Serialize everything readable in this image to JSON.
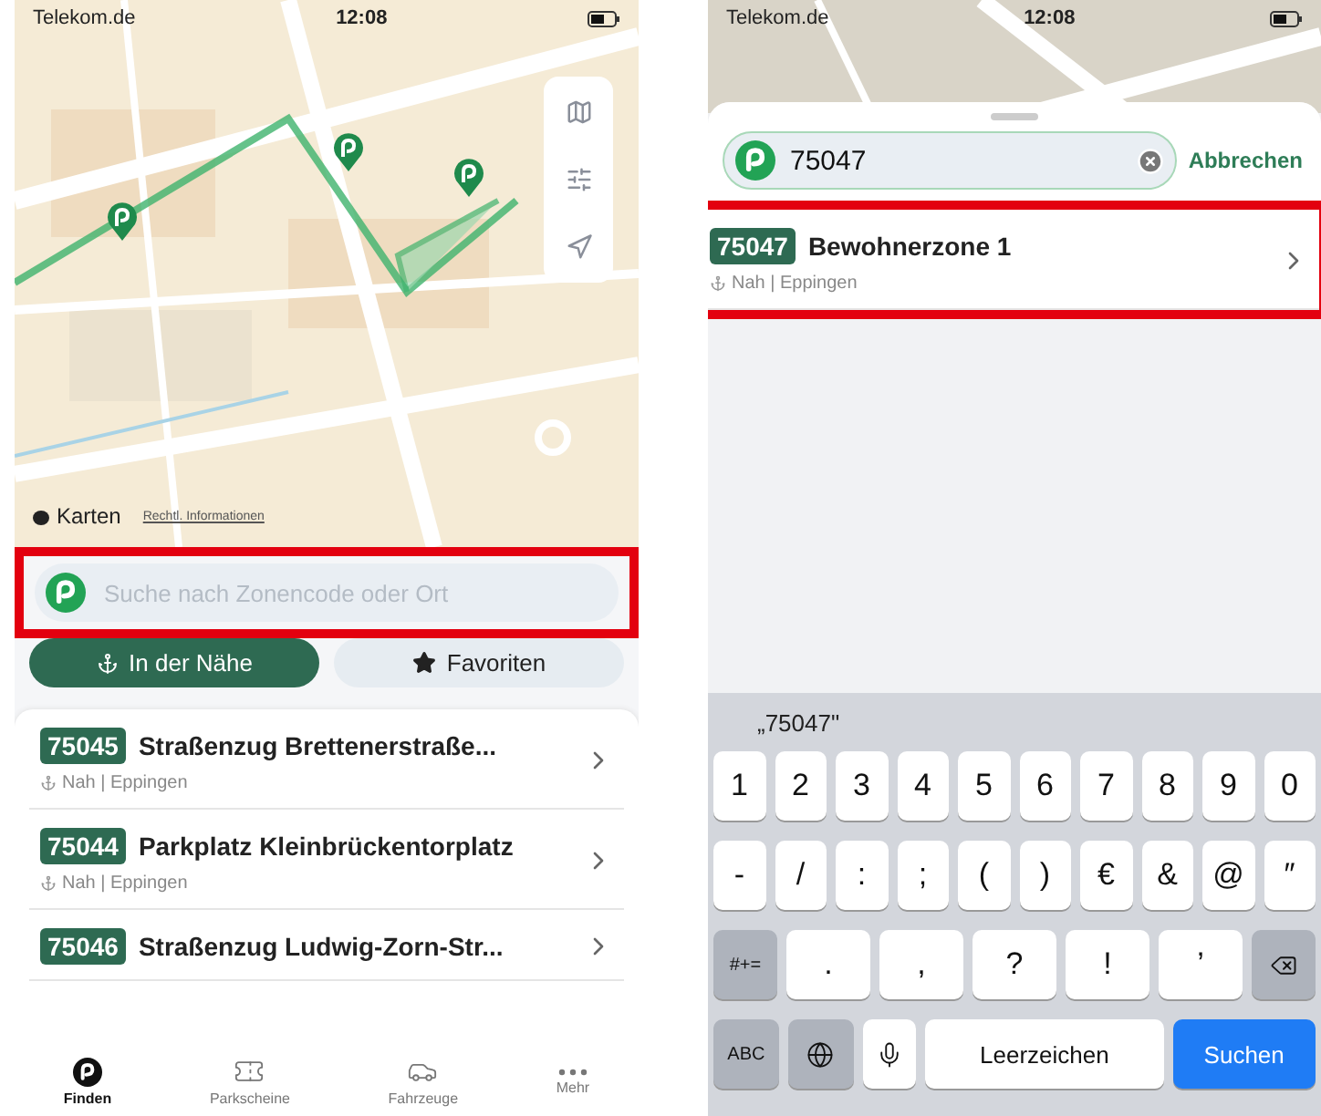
{
  "left_screen": {
    "status_bar": {
      "carrier": "Telekom.de",
      "time": "12:08"
    },
    "map": {
      "brand": "Karten",
      "legal_link": "Rechtl. Informationen"
    },
    "search": {
      "placeholder": "Suche nach Zonencode oder Ort",
      "highlighted": true
    },
    "tabs": [
      {
        "label": "In der Nähe",
        "selected": true
      },
      {
        "label": "Favoriten",
        "selected": false
      }
    ],
    "zones": [
      {
        "code": "75045",
        "name": "Straßenzug Brettenerstraße...",
        "meta": "Nah | Eppingen"
      },
      {
        "code": "75044",
        "name": "Parkplatz Kleinbrückentorplatz",
        "meta": "Nah | Eppingen"
      },
      {
        "code": "75046",
        "name": "Straßenzug Ludwig-Zorn-Str..."
      }
    ],
    "nav": [
      {
        "label": "Finden",
        "selected": true
      },
      {
        "label": "Parkscheine",
        "selected": false
      },
      {
        "label": "Fahrzeuge",
        "selected": false
      },
      {
        "label": "Mehr",
        "selected": false
      }
    ]
  },
  "right_screen": {
    "status_bar": {
      "carrier": "Telekom.de",
      "time": "12:08"
    },
    "search": {
      "value": "75047",
      "cancel": "Abbrechen"
    },
    "results": [
      {
        "code": "75047",
        "name": "Bewohnerzone 1",
        "meta": "Nah | Eppingen",
        "highlighted": true
      }
    ],
    "keyboard": {
      "suggestion": "„75047\"",
      "key_rows": [
        {
          "keys": [
            {
              "kind": "char",
              "label": "1"
            },
            {
              "kind": "char",
              "label": "2"
            },
            {
              "kind": "char",
              "label": "3"
            },
            {
              "kind": "char",
              "label": "4"
            },
            {
              "kind": "char",
              "label": "5"
            },
            {
              "kind": "char",
              "label": "6"
            },
            {
              "kind": "char",
              "label": "7"
            },
            {
              "kind": "char",
              "label": "8"
            },
            {
              "kind": "char",
              "label": "9"
            },
            {
              "kind": "char",
              "label": "0"
            }
          ]
        },
        {
          "keys": [
            {
              "kind": "char",
              "label": "-"
            },
            {
              "kind": "char",
              "label": "/"
            },
            {
              "kind": "char",
              "label": ":"
            },
            {
              "kind": "char",
              "label": ";"
            },
            {
              "kind": "char",
              "label": "("
            },
            {
              "kind": "char",
              "label": ")"
            },
            {
              "kind": "char",
              "label": "€"
            },
            {
              "kind": "char",
              "label": "&"
            },
            {
              "kind": "char",
              "label": "@"
            },
            {
              "kind": "char",
              "label": "″"
            }
          ]
        },
        {
          "keys": [
            {
              "kind": "function",
              "label": "#+="
            },
            {
              "kind": "wide",
              "label": "."
            },
            {
              "kind": "wide",
              "label": ","
            },
            {
              "kind": "wide",
              "label": "?"
            },
            {
              "kind": "wide",
              "label": "!"
            },
            {
              "kind": "wide",
              "label": "’"
            },
            {
              "kind": "backspace"
            }
          ]
        },
        {
          "keys": [
            {
              "kind": "function",
              "label": "ABC"
            },
            {
              "kind": "globe"
            },
            {
              "kind": "mic"
            },
            {
              "kind": "space",
              "label": "Leerzeichen"
            },
            {
              "kind": "action",
              "label": "Suchen"
            }
          ]
        }
      ]
    }
  }
}
